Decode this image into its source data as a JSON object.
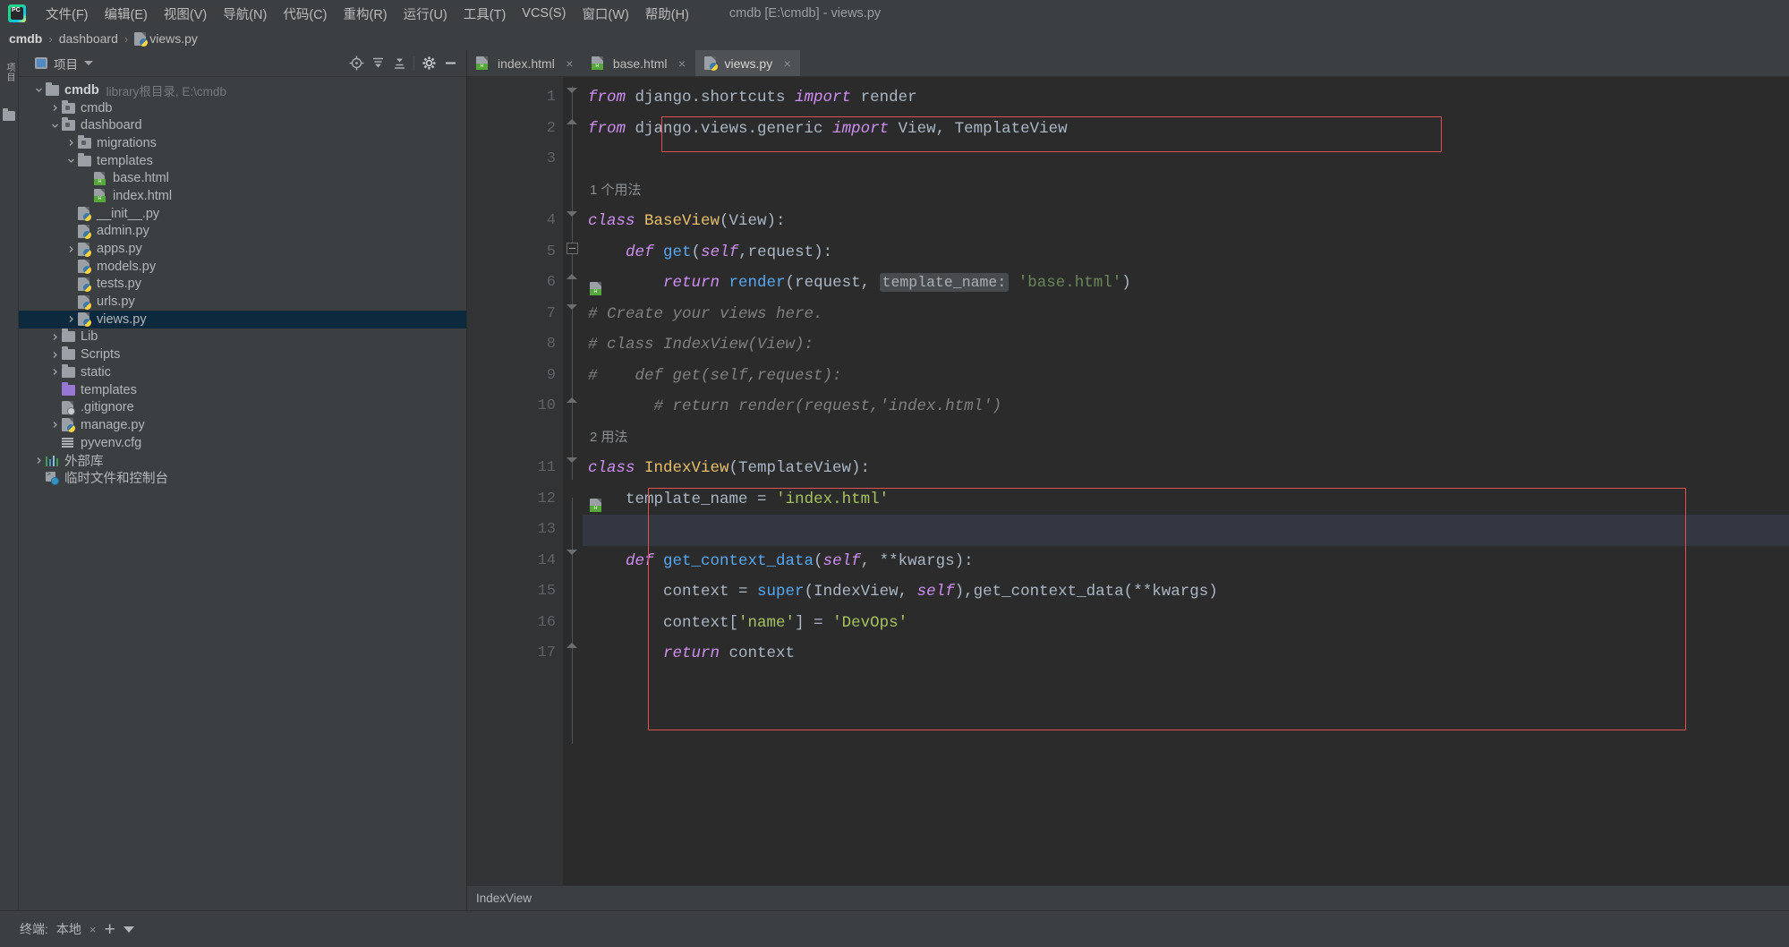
{
  "window": {
    "title": "cmdb [E:\\cmdb] - views.py",
    "logo": "pycharm-logo"
  },
  "menu": {
    "items": [
      {
        "label": "文件(F)"
      },
      {
        "label": "编辑(E)"
      },
      {
        "label": "视图(V)"
      },
      {
        "label": "导航(N)"
      },
      {
        "label": "代码(C)"
      },
      {
        "label": "重构(R)"
      },
      {
        "label": "运行(U)"
      },
      {
        "label": "工具(T)"
      },
      {
        "label": "VCS(S)"
      },
      {
        "label": "窗口(W)"
      },
      {
        "label": "帮助(H)"
      }
    ]
  },
  "breadcrumb": {
    "items": [
      {
        "label": "cmdb",
        "bold": true,
        "icon": ""
      },
      {
        "label": "dashboard",
        "bold": false,
        "icon": ""
      },
      {
        "label": "views.py",
        "bold": false,
        "icon": "python-file-icon"
      }
    ],
    "separator": "›"
  },
  "left_strip": {
    "vertical_tab_label": "项目",
    "structure_icon": "folder-icon"
  },
  "project_panel": {
    "title": "项目",
    "title_icon": "project-icon",
    "dropdown_icon": "chevron-down-icon",
    "toolbar_buttons": [
      {
        "name": "locate-icon"
      },
      {
        "name": "expand-all-icon"
      },
      {
        "name": "collapse-all-icon"
      },
      {
        "name": "settings-gear-icon"
      },
      {
        "name": "hide-minimize-icon"
      }
    ],
    "tree": [
      {
        "label": "cmdb",
        "hint": "library根目录, E:\\cmdb",
        "indent": 0,
        "arrow": "down",
        "icon": "folder-plain",
        "bold": true,
        "selected": false
      },
      {
        "label": "cmdb",
        "hint": "",
        "indent": 1,
        "arrow": "right",
        "icon": "folder-module",
        "bold": false,
        "selected": false
      },
      {
        "label": "dashboard",
        "hint": "",
        "indent": 1,
        "arrow": "down",
        "icon": "folder-module",
        "bold": false,
        "selected": false
      },
      {
        "label": "migrations",
        "hint": "",
        "indent": 2,
        "arrow": "right",
        "icon": "folder-module",
        "bold": false,
        "selected": false
      },
      {
        "label": "templates",
        "hint": "",
        "indent": 2,
        "arrow": "down",
        "icon": "folder-plain",
        "bold": false,
        "selected": false
      },
      {
        "label": "base.html",
        "hint": "",
        "indent": 3,
        "arrow": "none",
        "icon": "html-file",
        "bold": false,
        "selected": false
      },
      {
        "label": "index.html",
        "hint": "",
        "indent": 3,
        "arrow": "none",
        "icon": "html-file",
        "bold": false,
        "selected": false
      },
      {
        "label": "__init__.py",
        "hint": "",
        "indent": 2,
        "arrow": "none",
        "icon": "python-file",
        "bold": false,
        "selected": false
      },
      {
        "label": "admin.py",
        "hint": "",
        "indent": 2,
        "arrow": "none",
        "icon": "python-file",
        "bold": false,
        "selected": false
      },
      {
        "label": "apps.py",
        "hint": "",
        "indent": 2,
        "arrow": "right",
        "icon": "python-file",
        "bold": false,
        "selected": false
      },
      {
        "label": "models.py",
        "hint": "",
        "indent": 2,
        "arrow": "none",
        "icon": "python-file",
        "bold": false,
        "selected": false
      },
      {
        "label": "tests.py",
        "hint": "",
        "indent": 2,
        "arrow": "none",
        "icon": "python-file",
        "bold": false,
        "selected": false
      },
      {
        "label": "urls.py",
        "hint": "",
        "indent": 2,
        "arrow": "none",
        "icon": "python-file",
        "bold": false,
        "selected": false
      },
      {
        "label": "views.py",
        "hint": "",
        "indent": 2,
        "arrow": "right",
        "icon": "python-file",
        "bold": false,
        "selected": true
      },
      {
        "label": "Lib",
        "hint": "",
        "indent": 1,
        "arrow": "right",
        "icon": "folder-plain",
        "bold": false,
        "selected": false
      },
      {
        "label": "Scripts",
        "hint": "",
        "indent": 1,
        "arrow": "right",
        "icon": "folder-plain",
        "bold": false,
        "selected": false
      },
      {
        "label": "static",
        "hint": "",
        "indent": 1,
        "arrow": "right",
        "icon": "folder-plain",
        "bold": false,
        "selected": false
      },
      {
        "label": "templates",
        "hint": "",
        "indent": 1,
        "arrow": "none",
        "icon": "folder-purple",
        "bold": false,
        "selected": false
      },
      {
        "label": ".gitignore",
        "hint": "",
        "indent": 1,
        "arrow": "none",
        "icon": "gitignore-file",
        "bold": false,
        "selected": false
      },
      {
        "label": "manage.py",
        "hint": "",
        "indent": 1,
        "arrow": "right",
        "icon": "python-file",
        "bold": false,
        "selected": false
      },
      {
        "label": "pyvenv.cfg",
        "hint": "",
        "indent": 1,
        "arrow": "none",
        "icon": "config-file",
        "bold": false,
        "selected": false
      },
      {
        "label": "外部库",
        "hint": "",
        "indent": 0,
        "arrow": "right",
        "icon": "external-libraries",
        "bold": false,
        "selected": false
      },
      {
        "label": "临时文件和控制台",
        "hint": "",
        "indent": 0,
        "arrow": "none",
        "icon": "scratches-consoles",
        "bold": false,
        "selected": false
      }
    ]
  },
  "editor": {
    "tabs": [
      {
        "label": "index.html",
        "icon": "html-file-icon",
        "active": false,
        "close": "×"
      },
      {
        "label": "base.html",
        "icon": "html-file-icon",
        "active": false,
        "close": "×"
      },
      {
        "label": "views.py",
        "icon": "python-file-icon",
        "active": true,
        "close": "×"
      }
    ],
    "status_text": "IndexView",
    "lines": [
      {
        "num": "1",
        "tokens": [
          [
            "kw",
            "from "
          ],
          [
            "id",
            "django.shortcuts "
          ],
          [
            "kw",
            "import "
          ],
          [
            "id",
            "render"
          ]
        ]
      },
      {
        "num": "2",
        "tokens": [
          [
            "kw",
            "from "
          ],
          [
            "id",
            "django.views.generic "
          ],
          [
            "kw",
            "import "
          ],
          [
            "id",
            "View, TemplateView"
          ]
        ]
      },
      {
        "num": "3",
        "tokens": []
      },
      {
        "num": "",
        "inlay": "1 个用法"
      },
      {
        "num": "4",
        "tokens": [
          [
            "kw",
            "class "
          ],
          [
            "cls",
            "BaseView"
          ],
          [
            "op",
            "(View):"
          ]
        ]
      },
      {
        "num": "5",
        "tokens": [
          [
            "op",
            "    "
          ],
          [
            "kw",
            "def "
          ],
          [
            "fn",
            "get"
          ],
          [
            "op",
            "("
          ],
          [
            "sf",
            "self"
          ],
          [
            "op",
            ","
          ],
          [
            "id",
            "request"
          ],
          [
            "op",
            "):"
          ]
        ]
      },
      {
        "num": "6",
        "tokens": [
          [
            "op",
            "        "
          ],
          [
            "kw",
            "return "
          ],
          [
            "fn",
            "render"
          ],
          [
            "op",
            "("
          ],
          [
            "id",
            "request"
          ],
          [
            "op",
            ", "
          ],
          [
            "hint",
            "template_name:"
          ],
          [
            "str",
            " 'base.html'"
          ],
          [
            "op",
            ")"
          ]
        ]
      },
      {
        "num": "7",
        "tokens": [
          [
            "cm",
            "# Create your views here."
          ]
        ]
      },
      {
        "num": "8",
        "tokens": [
          [
            "cm",
            "# class IndexView(View):"
          ]
        ]
      },
      {
        "num": "9",
        "tokens": [
          [
            "cm",
            "#    def get(self,request):"
          ]
        ]
      },
      {
        "num": "10",
        "tokens": [
          [
            "cm",
            "       # return render(request,'index.html')"
          ]
        ]
      },
      {
        "num": "",
        "inlay": "2 用法"
      },
      {
        "num": "11",
        "tokens": [
          [
            "kw",
            "class "
          ],
          [
            "cls",
            "IndexView"
          ],
          [
            "op",
            "(TemplateView):"
          ]
        ]
      },
      {
        "num": "12",
        "tokens": [
          [
            "op",
            "    "
          ],
          [
            "id",
            "template_name"
          ],
          [
            "op",
            " = "
          ],
          [
            "str2",
            "'index.html'"
          ]
        ]
      },
      {
        "num": "13",
        "tokens": [],
        "highlight": true
      },
      {
        "num": "14",
        "tokens": [
          [
            "op",
            "    "
          ],
          [
            "kw",
            "def "
          ],
          [
            "fn",
            "get_context_data"
          ],
          [
            "op",
            "("
          ],
          [
            "sf",
            "self"
          ],
          [
            "op",
            ", "
          ],
          [
            "op",
            "**"
          ],
          [
            "id",
            "kwargs"
          ],
          [
            "op",
            "):"
          ]
        ]
      },
      {
        "num": "15",
        "tokens": [
          [
            "op",
            "        "
          ],
          [
            "id",
            "context"
          ],
          [
            "op",
            " = "
          ],
          [
            "fn",
            "super"
          ],
          [
            "op",
            "("
          ],
          [
            "id",
            "IndexView"
          ],
          [
            "op",
            ", "
          ],
          [
            "sf",
            "self"
          ],
          [
            "op",
            "),"
          ],
          [
            "mth",
            "get_context_data"
          ],
          [
            "op",
            "("
          ],
          [
            "op",
            "**"
          ],
          [
            "id",
            "kwargs"
          ],
          [
            "op",
            ")"
          ]
        ]
      },
      {
        "num": "16",
        "tokens": [
          [
            "op",
            "        "
          ],
          [
            "id",
            "context"
          ],
          [
            "op",
            "["
          ],
          [
            "str2",
            "'name'"
          ],
          [
            "op",
            "] = "
          ],
          [
            "str2",
            "'DevOps'"
          ]
        ]
      },
      {
        "num": "17",
        "tokens": [
          [
            "op",
            "        "
          ],
          [
            "kw",
            "return "
          ],
          [
            "id",
            "context"
          ]
        ]
      }
    ]
  },
  "bottom_bar": {
    "terminal_label": "终端:",
    "session_label": "本地",
    "close_icon": "×",
    "add_icon": "+",
    "chevron_icon": "chevron-down-icon"
  },
  "colors": {
    "accent": "#3592c4",
    "highlight_border": "#e05252",
    "selection": "#0d293e",
    "editor_bg": "#2b2b2b",
    "panel_bg": "#3c3f41"
  }
}
